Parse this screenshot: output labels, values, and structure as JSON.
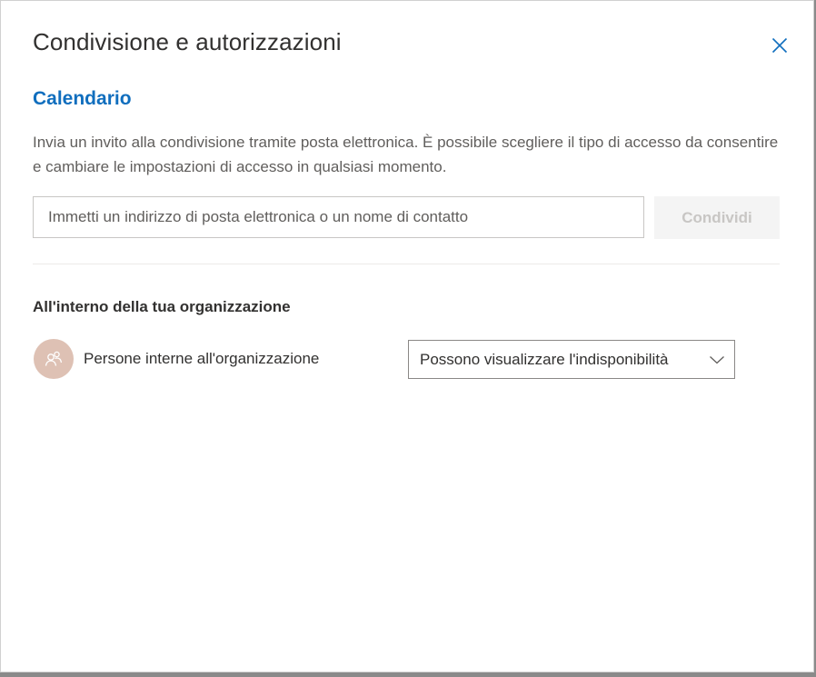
{
  "dialog": {
    "title": "Condivisione e autorizzazioni",
    "close_icon": "close-icon"
  },
  "section": {
    "heading": "Calendario",
    "description": "Invia un invito alla condivisione tramite posta elettronica. È possibile scegliere il tipo di accesso da consentire e cambiare le impostazioni di accesso in qualsiasi momento."
  },
  "share": {
    "input_value": "",
    "input_placeholder": "Immetti un indirizzo di posta elettronica o un nome di contatto",
    "button_label": "Condividi"
  },
  "organization": {
    "heading": "All'interno della tua organizzazione",
    "member": {
      "avatar_icon": "people-icon",
      "label": "Persone interne all'organizzazione",
      "permission": "Possono visualizzare l'indisponibilità",
      "dropdown_icon": "chevron-down-icon"
    }
  },
  "colors": {
    "accent": "#106ebe",
    "avatar_bg": "#dec1b4",
    "text_primary": "#323130",
    "text_secondary": "#605e5c",
    "button_disabled_bg": "#f4f4f4",
    "button_disabled_text": "#c8c6c4"
  }
}
